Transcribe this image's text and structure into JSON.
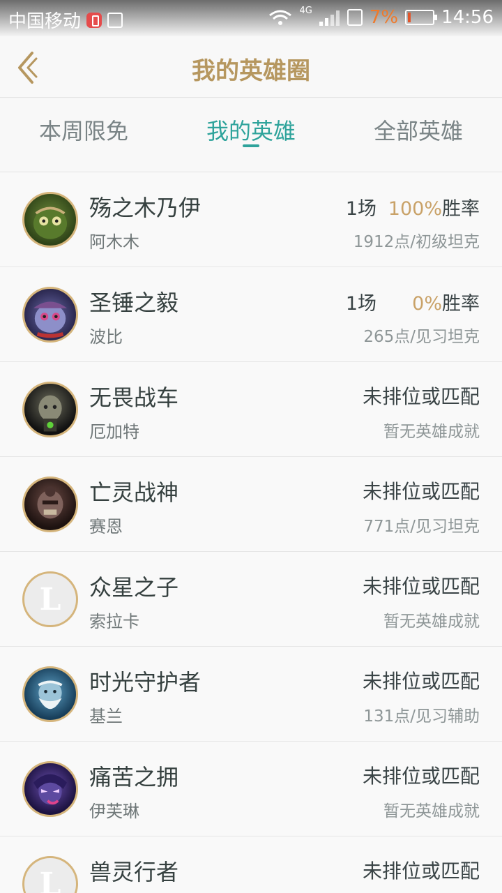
{
  "status_bar": {
    "carrier": "中国移动",
    "network": "4G",
    "battery": "7%",
    "time": "14:56"
  },
  "header": {
    "title": "我的英雄圈"
  },
  "tabs": [
    {
      "label": "本周限免",
      "active": false
    },
    {
      "label": "我的英雄",
      "active": true
    },
    {
      "label": "全部英雄",
      "active": false
    }
  ],
  "heroes": [
    {
      "name": "殇之木乃伊",
      "sub": "阿木木",
      "games": "1场",
      "pct": "100%",
      "rate_label": "胜率",
      "points": "1912点/初级坦克"
    },
    {
      "name": "圣锤之毅",
      "sub": "波比",
      "games": "1场",
      "pct": "0%",
      "rate_label": "胜率",
      "points": "265点/见习坦克"
    },
    {
      "name": "无畏战车",
      "sub": "厄加特",
      "status": "未排位或匹配",
      "points": "暂无英雄成就"
    },
    {
      "name": "亡灵战神",
      "sub": "赛恩",
      "status": "未排位或匹配",
      "points": "771点/见习坦克"
    },
    {
      "name": "众星之子",
      "sub": "索拉卡",
      "status": "未排位或匹配",
      "points": "暂无英雄成就",
      "avatar_letter": "L"
    },
    {
      "name": "时光守护者",
      "sub": "基兰",
      "status": "未排位或匹配",
      "points": "131点/见习辅助"
    },
    {
      "name": "痛苦之拥",
      "sub": "伊芙琳",
      "status": "未排位或匹配",
      "points": "暂无英雄成就"
    },
    {
      "name": "兽灵行者",
      "sub": "",
      "status": "未排位或匹配",
      "points": "",
      "avatar_letter": "L"
    }
  ],
  "colors": {
    "accent_gold": "#b6975f",
    "tab_active": "#2ea39b",
    "win_rate": "#c9a268"
  }
}
